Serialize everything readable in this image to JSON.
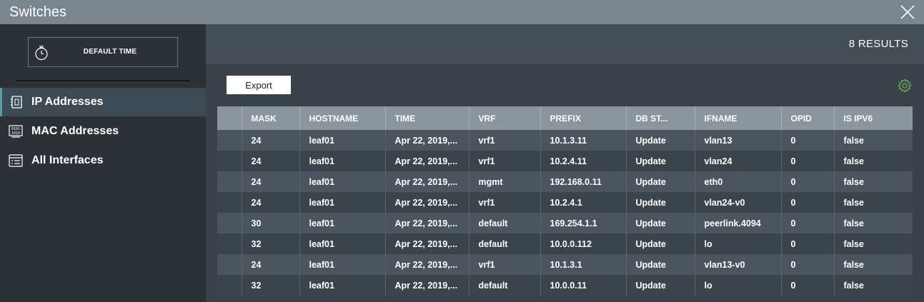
{
  "window": {
    "title": "Switches"
  },
  "sidebar": {
    "time_button": "DEFAULT TIME",
    "items": [
      {
        "label": "IP Addresses",
        "icon": "device-icon",
        "active": true
      },
      {
        "label": "MAC Addresses",
        "icon": "binary-icon",
        "active": false
      },
      {
        "label": "All Interfaces",
        "icon": "list-icon",
        "active": false
      }
    ]
  },
  "results": {
    "count": "8 RESULTS"
  },
  "toolbar": {
    "export_label": "Export"
  },
  "table": {
    "columns": [
      "",
      "MASK",
      "HOSTNAME",
      "TIME",
      "VRF",
      "PREFIX",
      "DB ST...",
      "IFNAME",
      "OPID",
      "IS IPV6"
    ],
    "rows": [
      [
        "24",
        "leaf01",
        "Apr 22, 2019,...",
        "vrf1",
        "10.1.3.11",
        "Update",
        "vlan13",
        "0",
        "false"
      ],
      [
        "24",
        "leaf01",
        "Apr 22, 2019,...",
        "vrf1",
        "10.2.4.11",
        "Update",
        "vlan24",
        "0",
        "false"
      ],
      [
        "24",
        "leaf01",
        "Apr 22, 2019,...",
        "mgmt",
        "192.168.0.11",
        "Update",
        "eth0",
        "0",
        "false"
      ],
      [
        "24",
        "leaf01",
        "Apr 22, 2019,...",
        "vrf1",
        "10.2.4.1",
        "Update",
        "vlan24-v0",
        "0",
        "false"
      ],
      [
        "30",
        "leaf01",
        "Apr 22, 2019,...",
        "default",
        "169.254.1.1",
        "Update",
        "peerlink.4094",
        "0",
        "false"
      ],
      [
        "32",
        "leaf01",
        "Apr 22, 2019,...",
        "default",
        "10.0.0.112",
        "Update",
        "lo",
        "0",
        "false"
      ],
      [
        "24",
        "leaf01",
        "Apr 22, 2019,...",
        "vrf1",
        "10.1.3.1",
        "Update",
        "vlan13-v0",
        "0",
        "false"
      ],
      [
        "32",
        "leaf01",
        "Apr 22, 2019,...",
        "default",
        "10.0.0.11",
        "Update",
        "lo",
        "0",
        "false"
      ]
    ]
  },
  "colors": {
    "accent": "#5a9aa8",
    "gear": "#6aa84f",
    "header": "#8a959e",
    "titlebar": "#7b858e"
  }
}
